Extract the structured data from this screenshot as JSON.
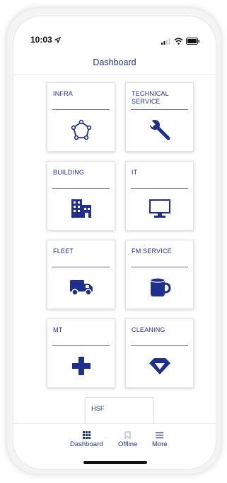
{
  "status_bar": {
    "time": "10:03"
  },
  "header": {
    "title": "Dashboard"
  },
  "tiles": [
    {
      "label": "INFRA",
      "icon": "network-polygon-icon"
    },
    {
      "label": "TECHNICAL SERVICE",
      "icon": "wrench-icon"
    },
    {
      "label": "BUILDING",
      "icon": "building-icon"
    },
    {
      "label": "IT",
      "icon": "monitor-icon"
    },
    {
      "label": "FLEET",
      "icon": "truck-icon"
    },
    {
      "label": "FM SERVICE",
      "icon": "mug-icon"
    },
    {
      "label": "MT",
      "icon": "plus-icon"
    },
    {
      "label": "CLEANING",
      "icon": "diamond-icon"
    },
    {
      "label": "HSF",
      "icon": ""
    }
  ],
  "tabbar": {
    "items": [
      {
        "label": "Dashboard",
        "icon": "grid-icon"
      },
      {
        "label": "Offline",
        "icon": "bookmark-icon"
      },
      {
        "label": "More",
        "icon": "menu-icon"
      }
    ]
  },
  "colors": {
    "accent": "#1f2f8f"
  }
}
